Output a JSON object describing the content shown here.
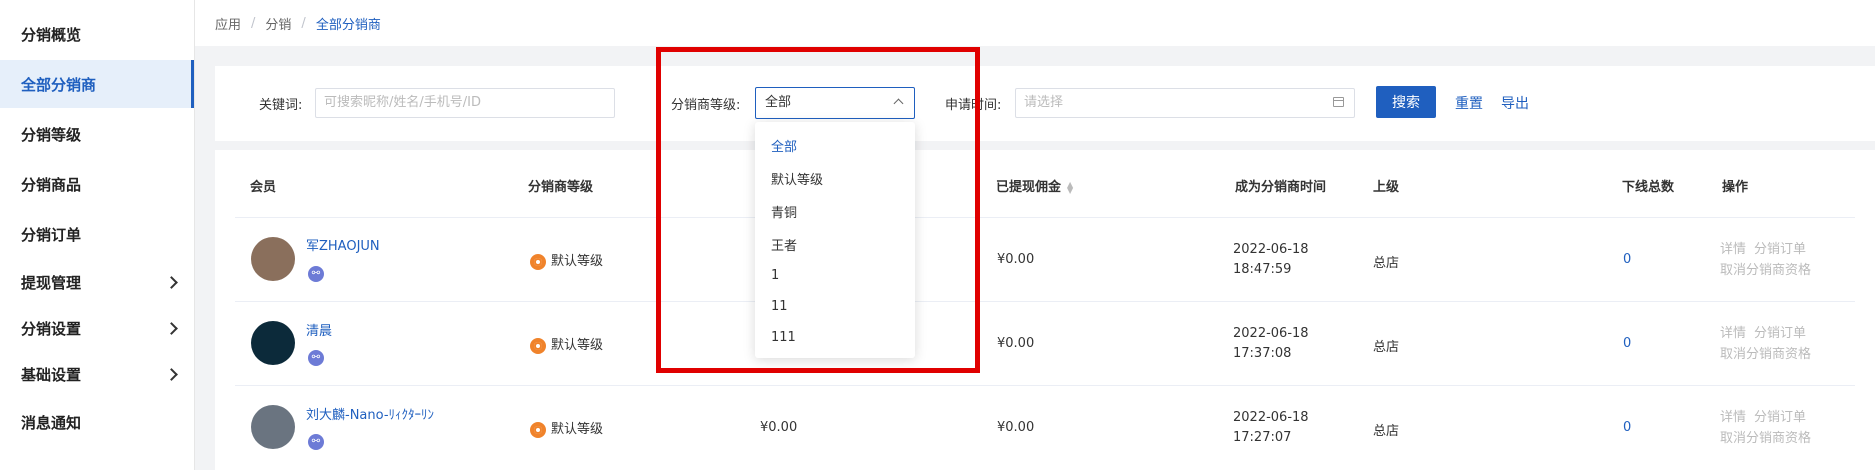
{
  "sidebar": {
    "items": [
      {
        "label": "分销概览",
        "active": false,
        "expandable": false
      },
      {
        "label": "全部分销商",
        "active": true,
        "expandable": false
      },
      {
        "label": "分销等级",
        "active": false,
        "expandable": false
      },
      {
        "label": "分销商品",
        "active": false,
        "expandable": false
      },
      {
        "label": "分销订单",
        "active": false,
        "expandable": false
      },
      {
        "label": "提现管理",
        "active": false,
        "expandable": true
      },
      {
        "label": "分销设置",
        "active": false,
        "expandable": true
      },
      {
        "label": "基础设置",
        "active": false,
        "expandable": true
      },
      {
        "label": "消息通知",
        "active": false,
        "expandable": false
      }
    ]
  },
  "breadcrumb": [
    "应用",
    "分销",
    "全部分销商"
  ],
  "filters": {
    "keyword_label": "关键词:",
    "keyword_placeholder": "可搜索昵称/姓名/手机号/ID",
    "level_label": "分销商等级:",
    "level_value": "全部",
    "time_label": "申请时间:",
    "time_placeholder": "请选择",
    "search_button": "搜索",
    "reset_link": "重置",
    "export_link": "导出"
  },
  "level_dropdown": {
    "options": [
      "全部",
      "默认等级",
      "青铜",
      "王者",
      "1",
      "11",
      "111"
    ],
    "selected": "全部"
  },
  "table": {
    "columns": {
      "member": "会员",
      "level": "分销商等级",
      "withdrawn": "已提现佣金",
      "since": "成为分销商时间",
      "superior": "上级",
      "downline": "下线总数",
      "actions": "操作"
    },
    "rows": [
      {
        "name": "军ZHAOJUN",
        "level": "默认等级",
        "col3": "",
        "withdrawn": "¥0.00",
        "date": "2022-06-18",
        "time": "18:47:59",
        "superior": "总店",
        "downline": "0",
        "avatar_color": "#8a6f5c"
      },
      {
        "name": "清晨",
        "level": "默认等级",
        "col3": "",
        "withdrawn": "¥0.00",
        "date": "2022-06-18",
        "time": "17:37:08",
        "superior": "总店",
        "downline": "0",
        "avatar_color": "#0c2a3a"
      },
      {
        "name": "刘大麟-Nano-ﾘｨｸﾀｰﾘﾝ",
        "level": "默认等级",
        "col3": "¥0.00",
        "withdrawn": "¥0.00",
        "date": "2022-06-18",
        "time": "17:27:07",
        "superior": "总店",
        "downline": "0",
        "avatar_color": "#6a7480"
      }
    ],
    "row_actions": [
      "详情",
      "分销订单",
      "取消分销商资格"
    ]
  }
}
